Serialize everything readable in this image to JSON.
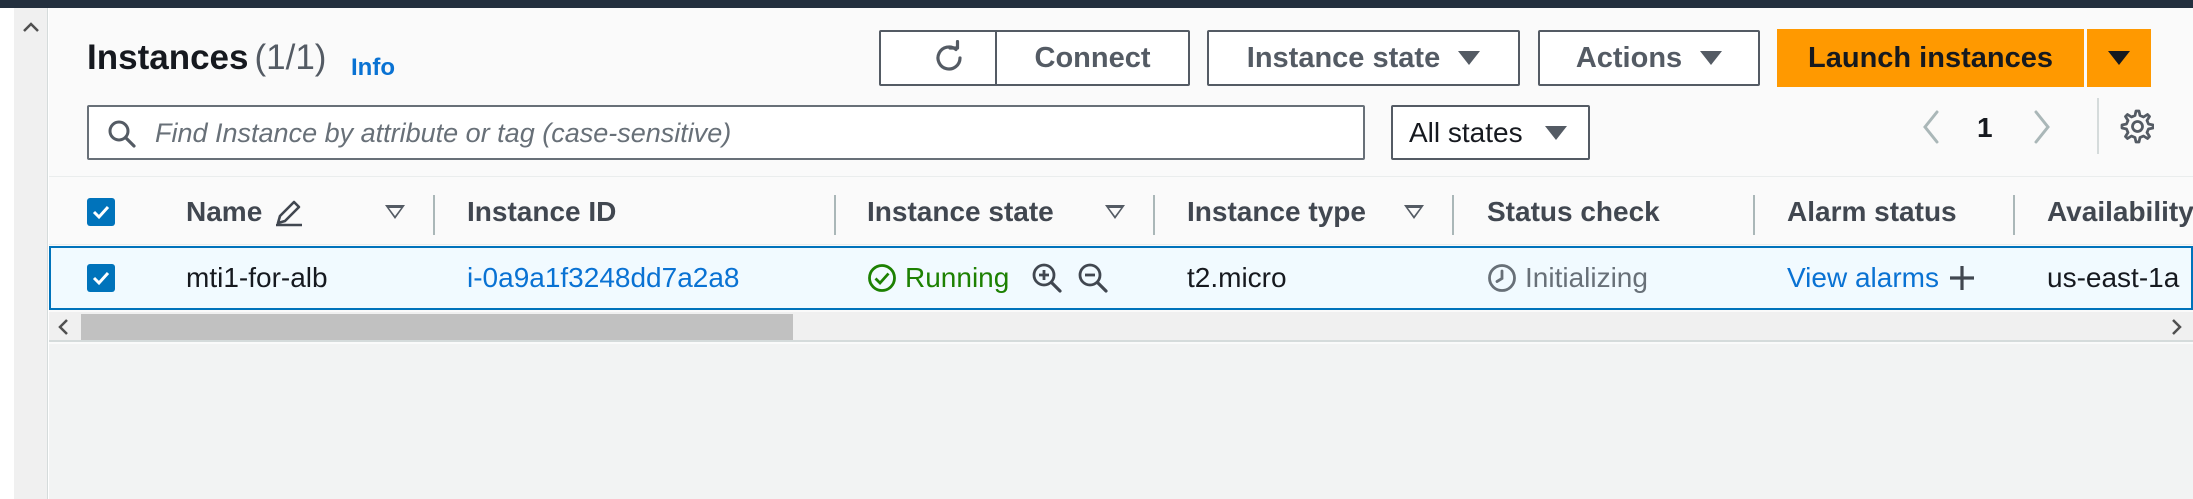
{
  "header": {
    "title": "Instances",
    "count": "(1/1)",
    "info_label": "Info"
  },
  "toolbar": {
    "connect_label": "Connect",
    "instance_state_label": "Instance state",
    "actions_label": "Actions",
    "launch_label": "Launch instances"
  },
  "search": {
    "placeholder": "Find Instance by attribute or tag (case-sensitive)"
  },
  "filter": {
    "selected": "All states"
  },
  "pagination": {
    "current_page": "1"
  },
  "table": {
    "columns": {
      "name": "Name",
      "instance_id": "Instance ID",
      "instance_state": "Instance state",
      "instance_type": "Instance type",
      "status_check": "Status check",
      "alarm_status": "Alarm status",
      "availability": "Availability"
    },
    "rows": [
      {
        "name": "mti1-for-alb",
        "instance_id": "i-0a9a1f3248dd7a2a8",
        "instance_state": "Running",
        "instance_type": "t2.micro",
        "status_check": "Initializing",
        "alarm_status": "View alarms",
        "availability_zone": "us-east-1a"
      }
    ]
  },
  "colors": {
    "accent_orange": "#ff9900",
    "link_blue": "#0972d3",
    "running_green": "#1d8102",
    "selection_blue": "#0073bb"
  }
}
